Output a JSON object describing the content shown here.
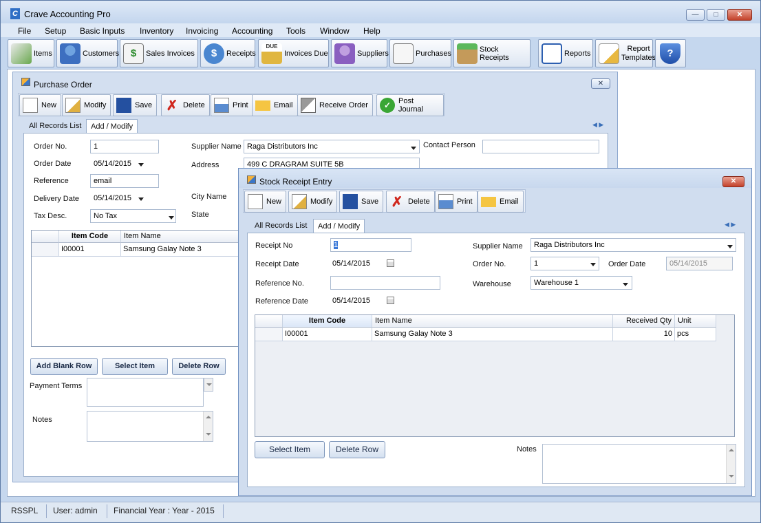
{
  "app": {
    "title": "Crave Accounting Pro",
    "accent": "#c5d7ee"
  },
  "menu": [
    "File",
    "Setup",
    "Basic Inputs",
    "Inventory",
    "Invoicing",
    "Accounting",
    "Tools",
    "Window",
    "Help"
  ],
  "toolbar": {
    "items": "Items",
    "customers": "Customers",
    "sales_invoices": "Sales Invoices",
    "receipts": "Receipts",
    "invoices_due": "Invoices Due",
    "suppliers": "Suppliers",
    "purchases": "Purchases",
    "stock_receipts": "Stock Receipts",
    "reports": "Reports",
    "report_templates_1": "Report",
    "report_templates_2": "Templates",
    "due_badge": "DUE",
    "dollar": "$"
  },
  "purchase_order": {
    "title": "Purchase Order",
    "buttons": {
      "new": "New",
      "modify": "Modify",
      "save": "Save",
      "delete": "Delete",
      "print": "Print",
      "email": "Email",
      "receive": "Receive Order",
      "post": "Post Journal"
    },
    "tabs": {
      "list": "All Records List",
      "add": "Add / Modify"
    },
    "labels": {
      "order_no": "Order No.",
      "order_date": "Order Date",
      "reference": "Reference",
      "delivery_date": "Delivery Date",
      "tax_desc": "Tax Desc.",
      "supplier_name": "Supplier Name",
      "address": "Address",
      "city": "City Name",
      "state": "State",
      "contact": "Contact Person",
      "payment_terms": "Payment Terms",
      "notes": "Notes"
    },
    "values": {
      "order_no": "1",
      "order_date": "05/14/2015",
      "reference": "email",
      "delivery_date": "05/14/2015",
      "tax_desc": "No Tax",
      "supplier_name": "Raga Distributors Inc",
      "address": "499 C DRAGRAM SUITE 5B",
      "contact": ""
    },
    "grid": {
      "headers": [
        "Item Code",
        "Item Name"
      ],
      "rows": [
        [
          "I00001",
          "Samsung Galay Note 3"
        ]
      ]
    },
    "grid_buttons": {
      "add_blank": "Add Blank Row",
      "select": "Select Item",
      "delete": "Delete Row"
    }
  },
  "stock_receipt": {
    "title": "Stock Receipt Entry",
    "buttons": {
      "new": "New",
      "modify": "Modify",
      "save": "Save",
      "delete": "Delete",
      "print": "Print",
      "email": "Email"
    },
    "tabs": {
      "list": "All Records List",
      "add": "Add / Modify"
    },
    "labels": {
      "receipt_no": "Receipt No",
      "receipt_date": "Receipt Date",
      "reference_no": "Reference No.",
      "reference_date": "Reference Date",
      "supplier_name": "Supplier Name",
      "order_no": "Order No.",
      "order_date": "Order Date",
      "warehouse": "Warehouse",
      "notes": "Notes"
    },
    "values": {
      "receipt_no": "1",
      "receipt_date": "05/14/2015",
      "reference_no": "",
      "reference_date": "05/14/2015",
      "supplier_name": "Raga Distributors Inc",
      "order_no": "1",
      "order_date": "05/14/2015",
      "warehouse": "Warehouse 1"
    },
    "grid": {
      "headers": [
        "Item Code",
        "Item Name",
        "Received Qty",
        "Unit"
      ],
      "rows": [
        [
          "I00001",
          "Samsung Galay Note 3",
          "10",
          "pcs"
        ]
      ]
    },
    "grid_buttons": {
      "select": "Select Item",
      "delete": "Delete Row"
    }
  },
  "status": {
    "company": "RSSPL",
    "user": "User: admin",
    "year": "Financial Year : Year - 2015"
  }
}
